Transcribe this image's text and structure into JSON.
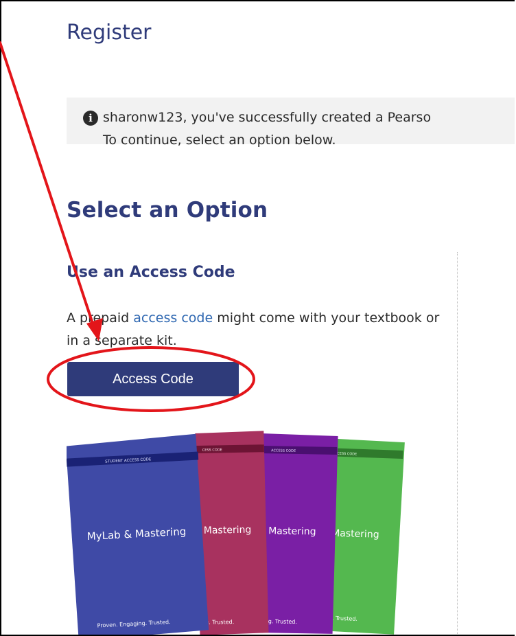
{
  "header": {
    "title": "Register"
  },
  "notice": {
    "icon": "info-icon",
    "line1": "sharonw123, you've successfully created a Pearso",
    "line2": "To continue, select an option below."
  },
  "options": {
    "title": "Select an Option",
    "access_code": {
      "title": "Use an Access Code",
      "desc_before": "A prepaid ",
      "desc_link": "access code",
      "desc_after": " might come with your textbook or in a separate kit.",
      "button_label": "Access Code"
    }
  },
  "kit_image": {
    "cards": [
      {
        "color": "#3f4aa6",
        "band": "STUDENT ACCESS CODE",
        "title": "MyLab & Mastering",
        "tagline": "Proven. Engaging. Trusted."
      },
      {
        "color": "#a8325f",
        "band": "CESS CODE",
        "title": "Mastering",
        "tagline": "g. Trusted."
      },
      {
        "color": "#7a1fa5",
        "band": "ACCESS CODE",
        "title": "Mastering",
        "tagline": "g. Trusted."
      },
      {
        "color": "#54b84f",
        "band": "CESS CODE",
        "title": "Mastering",
        "tagline": "g. Trusted."
      }
    ]
  },
  "annotation": {
    "color": "#e3151a"
  }
}
